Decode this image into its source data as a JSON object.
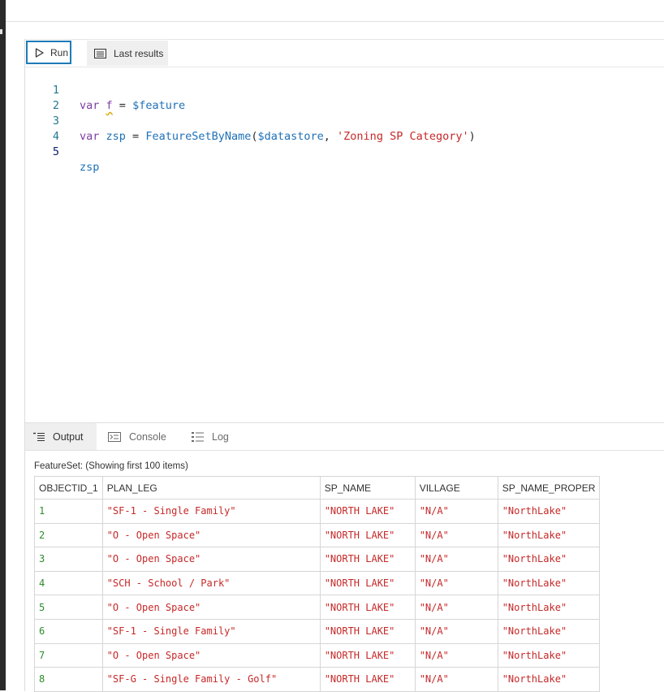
{
  "toolbar": {
    "run_label": "Run",
    "last_results_label": "Last results"
  },
  "editor": {
    "line_numbers": [
      "1",
      "2",
      "3",
      "4",
      "5"
    ],
    "lines": [
      {
        "kw": "var",
        "ident": "f",
        "eq": " = ",
        "value": "$feature"
      },
      {},
      {
        "kw": "var",
        "ident": "zsp",
        "eq": " = ",
        "fn": "FeatureSetByName",
        "open": "(",
        "arg1": "$datastore",
        "comma": ", ",
        "arg2": "'Zoning SP Category'",
        "close": ")"
      },
      {},
      {
        "ident": "zsp"
      }
    ]
  },
  "output_tabs": {
    "output_label": "Output",
    "console_label": "Console",
    "log_label": "Log"
  },
  "results": {
    "caption": "FeatureSet: (Showing first 100 items)",
    "columns": [
      "OBJECTID_1",
      "PLAN_LEG",
      "SP_NAME",
      "VILLAGE",
      "SP_NAME_PROPER"
    ],
    "rows": [
      [
        "1",
        "\"SF-1 - Single Family\"",
        "\"NORTH LAKE\"",
        "\"N/A\"",
        "\"NorthLake\""
      ],
      [
        "2",
        "\"O - Open Space\"",
        "\"NORTH LAKE\"",
        "\"N/A\"",
        "\"NorthLake\""
      ],
      [
        "3",
        "\"O - Open Space\"",
        "\"NORTH LAKE\"",
        "\"N/A\"",
        "\"NorthLake\""
      ],
      [
        "4",
        "\"SCH - School / Park\"",
        "\"NORTH LAKE\"",
        "\"N/A\"",
        "\"NorthLake\""
      ],
      [
        "5",
        "\"O - Open Space\"",
        "\"NORTH LAKE\"",
        "\"N/A\"",
        "\"NorthLake\""
      ],
      [
        "6",
        "\"SF-1 - Single Family\"",
        "\"NORTH LAKE\"",
        "\"N/A\"",
        "\"NorthLake\""
      ],
      [
        "7",
        "\"O - Open Space\"",
        "\"NORTH LAKE\"",
        "\"N/A\"",
        "\"NorthLake\""
      ],
      [
        "8",
        "\"SF-G - Single Family - Golf\"",
        "\"NORTH LAKE\"",
        "\"N/A\"",
        "\"NorthLake\""
      ]
    ]
  }
}
